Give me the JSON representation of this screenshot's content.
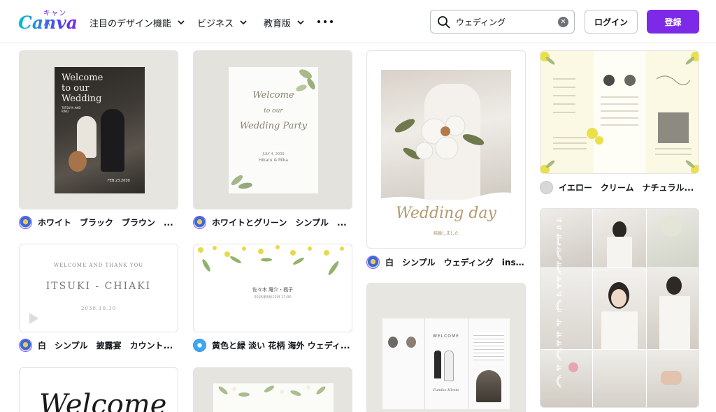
{
  "header": {
    "logo_kana": "キャンバ",
    "logo_word": "Canva",
    "nav": [
      {
        "label": "注目のデザイン機能"
      },
      {
        "label": "ビジネス"
      },
      {
        "label": "教育版"
      }
    ],
    "more_icon": "more-horizontal-icon",
    "search": {
      "value": "ウェディング",
      "placeholder": ""
    },
    "login_label": "ログイン",
    "signup_label": "登録"
  },
  "colors": {
    "brand": "#7d2ae8",
    "text": "#0e1318"
  },
  "cards": [
    {
      "id": "c1",
      "title_lines": [
        "Welcome",
        "to our",
        "Wedding"
      ],
      "names": "TATSUYA AND RINO",
      "date": "FEB.23.2030",
      "caption": "ホワイト　ブラック　ブラウン　..."
    },
    {
      "id": "c2",
      "title_lines": [
        "Welcome",
        "to our",
        "Wedding Party"
      ],
      "date": "JULY 4, 2030",
      "names": "Hikaru & Mika",
      "caption": "ホワイトとグリーン　シンプル　..."
    },
    {
      "id": "c3",
      "title": "Wedding day",
      "sub": "結婚しました",
      "caption": "白　シンプル　ウェディング　inst..."
    },
    {
      "id": "c4",
      "caption": "イエロー　クリーム　ナチュラル..."
    },
    {
      "id": "c5",
      "line1": "WELCOME AND THANK YOU",
      "names": "ITSUKI - CHIAKI",
      "date": "2030.10.10",
      "caption": "白　シンプル　披露宴　カウント..."
    },
    {
      "id": "c6",
      "names": "佐々木 庵介・楓子",
      "date": "2025年8月12日 17:00",
      "caption": "黄色と緑 淡い 花柄 海外 ウェディ..."
    },
    {
      "id": "c7",
      "title": "Welcome"
    },
    {
      "id": "c8"
    },
    {
      "id": "c9",
      "heading": "WELCOME",
      "names": "Fumiko  Hiroto"
    },
    {
      "id": "c10",
      "title": "WEDDING PHOTO"
    }
  ]
}
